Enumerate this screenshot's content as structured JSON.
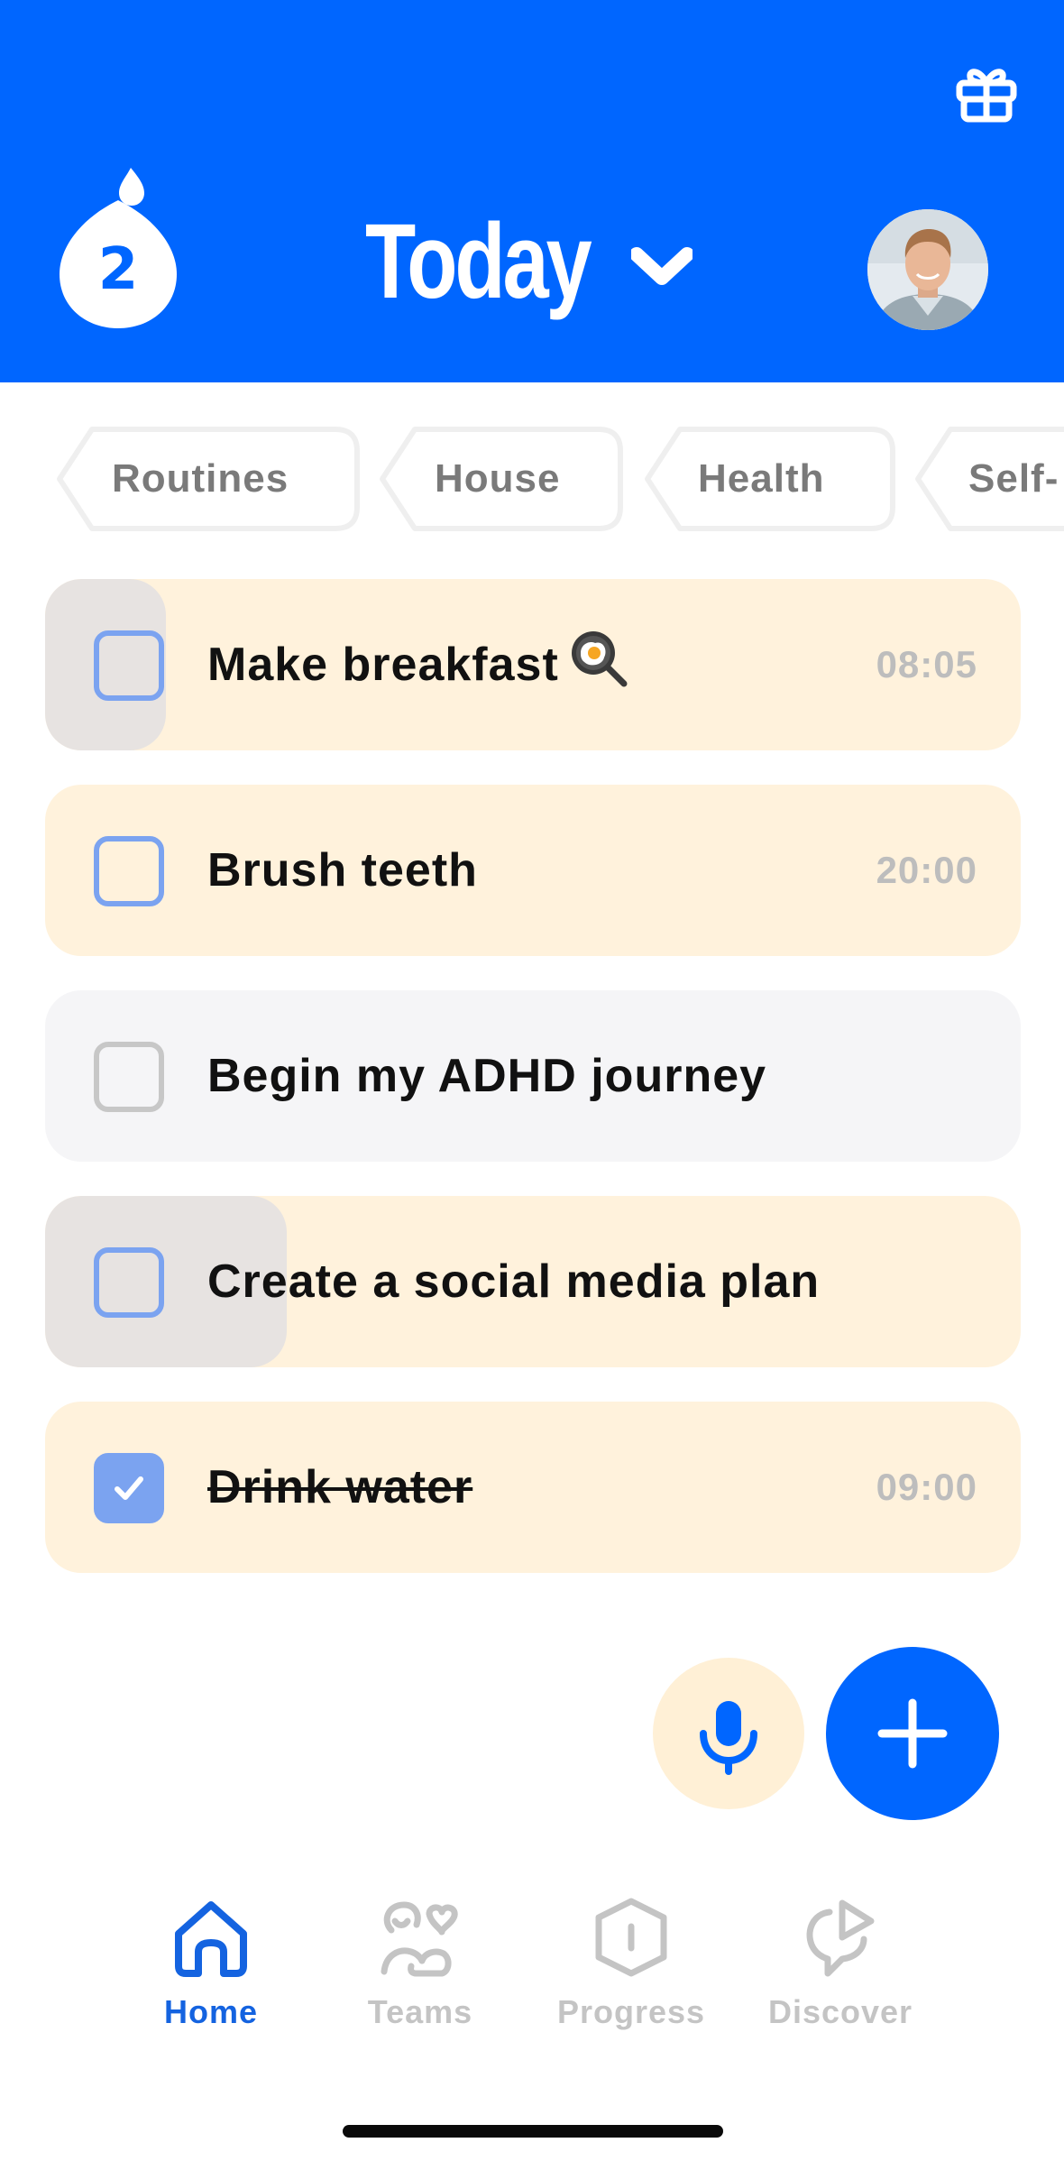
{
  "header": {
    "title": "Today",
    "streak_count": "2",
    "icons": {
      "gift": "gift-icon",
      "streak": "flame-drop-icon",
      "dropdown": "chevron-down-icon",
      "avatar": "user-avatar"
    },
    "background_color": "#0066FF"
  },
  "categories": [
    {
      "label": "Routines"
    },
    {
      "label": "House"
    },
    {
      "label": "Health"
    },
    {
      "label": "Self-"
    }
  ],
  "tasks": [
    {
      "label": "Make breakfast",
      "emoji": "frying-pan-egg-icon",
      "time": "08:05",
      "checked": false,
      "style": "peach"
    },
    {
      "label": "Brush teeth",
      "time": "20:00",
      "checked": false,
      "style": "peach"
    },
    {
      "label": "Begin my ADHD journey",
      "time": "",
      "checked": false,
      "style": "gray"
    },
    {
      "label": "Create a social media plan",
      "time": "",
      "checked": false,
      "style": "peach"
    },
    {
      "label": "Drink water",
      "time": "09:00",
      "checked": true,
      "style": "peach"
    }
  ],
  "actions": {
    "voice": "microphone-icon",
    "add": "plus-icon"
  },
  "nav": [
    {
      "label": "Home",
      "icon": "home-icon",
      "active": true
    },
    {
      "label": "Teams",
      "icon": "teams-icon",
      "active": false
    },
    {
      "label": "Progress",
      "icon": "progress-icon",
      "active": false
    },
    {
      "label": "Discover",
      "icon": "discover-icon",
      "active": false
    }
  ],
  "colors": {
    "accent": "#0066FF",
    "task_peach": "#FFF2DC",
    "task_gray": "#F5F5F7",
    "checkbox": "#7BA3F0"
  }
}
